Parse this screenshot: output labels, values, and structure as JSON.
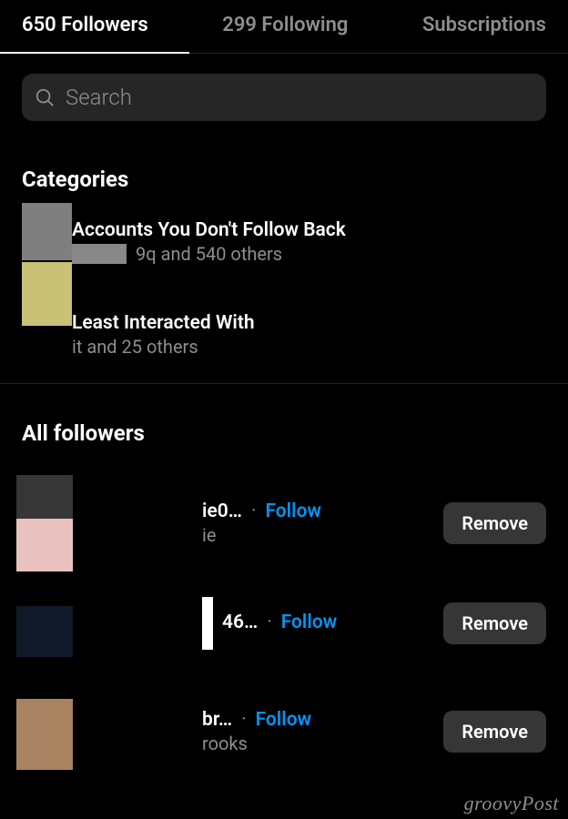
{
  "tabs": {
    "followers": "650 Followers",
    "following": "299 Following",
    "subscriptions": "Subscriptions"
  },
  "search": {
    "placeholder": "Search"
  },
  "categories": {
    "header": "Categories",
    "items": [
      {
        "title": "Accounts You Don't Follow Back",
        "sub": "9q and 540 others"
      },
      {
        "title": "Least Interacted With",
        "sub": "it and 25 others"
      }
    ]
  },
  "all_followers": {
    "header": "All followers",
    "follow_label": "Follow",
    "remove_label": "Remove",
    "rows": [
      {
        "username": "ie0…",
        "display": "ie"
      },
      {
        "username": "46…",
        "display": ""
      },
      {
        "username": "br…",
        "display": "rooks"
      }
    ]
  },
  "watermark": "groovyPost"
}
